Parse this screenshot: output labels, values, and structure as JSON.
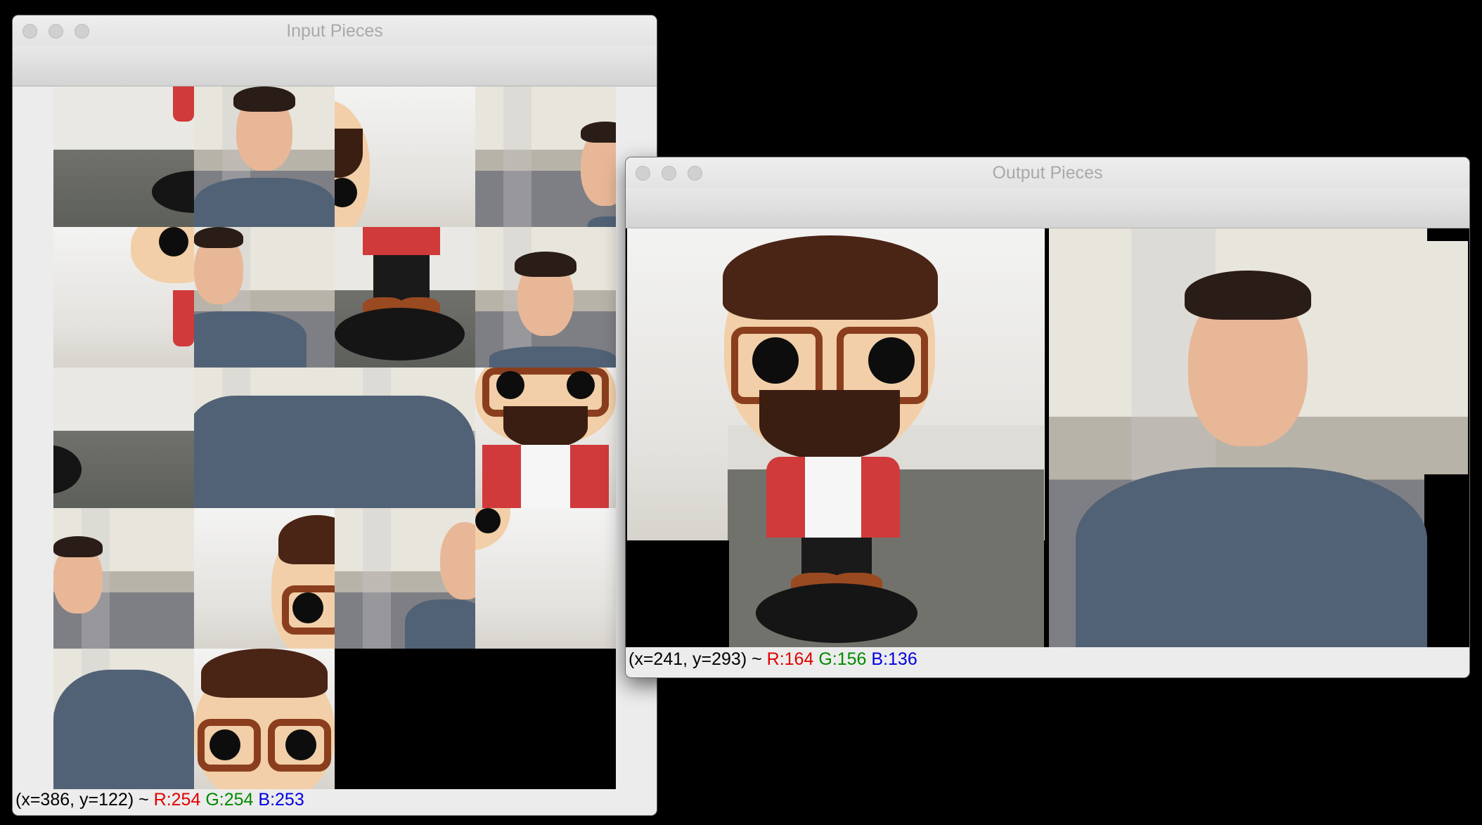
{
  "input_window": {
    "title": "Input Pieces",
    "status": {
      "coords": "(x=386, y=122) ~ ",
      "r": "R:254",
      "g": "G:254",
      "b": "B:253"
    }
  },
  "output_window": {
    "title": "Output Pieces",
    "status": {
      "coords": "(x=241, y=293) ~ ",
      "r": "R:164",
      "g": "G:156",
      "b": "B:136"
    }
  },
  "colors": {
    "r": "#e00000",
    "g": "#008a00",
    "b": "#0000e0"
  }
}
